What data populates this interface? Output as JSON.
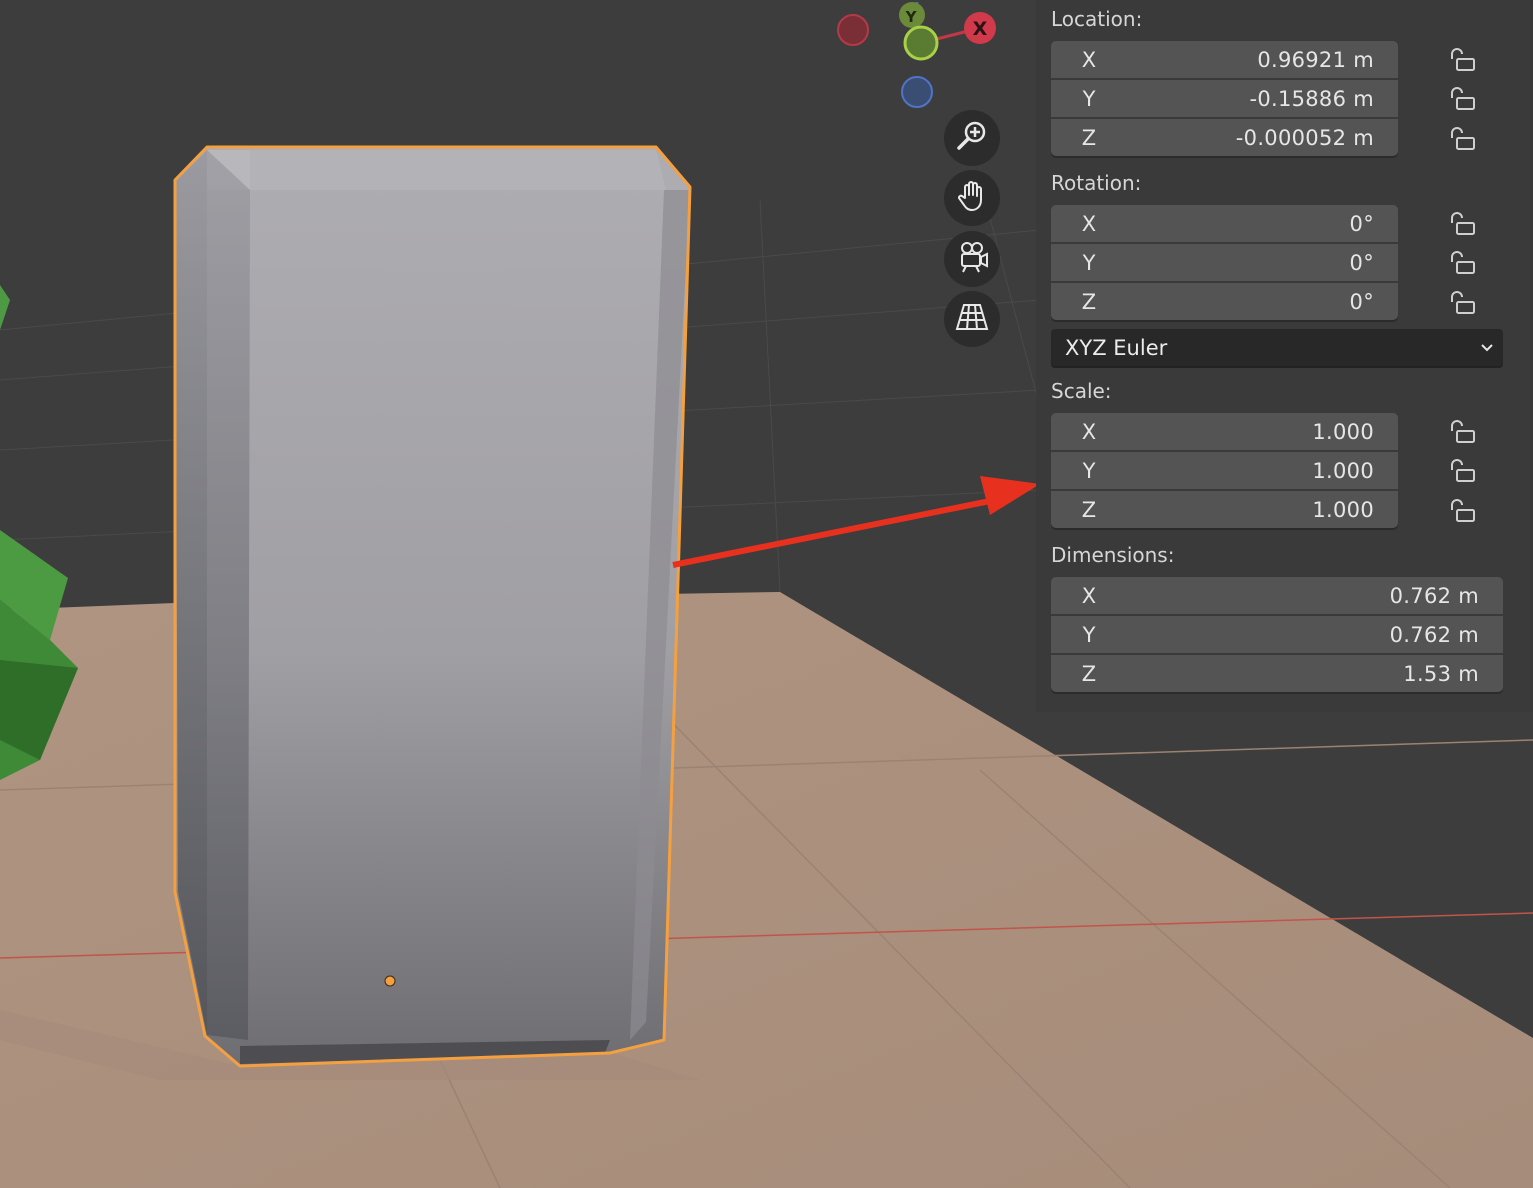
{
  "viewport": {
    "colors": {
      "background": "#3d3d3d",
      "floor": "#a8907e",
      "object": "#a7a6aa",
      "selection_outline": "#f5a040",
      "annotation_arrow": "#e8301f"
    },
    "gizmo": {
      "x_label": "X",
      "y_label": "Y"
    },
    "nav_buttons": [
      {
        "icon": "zoom-icon"
      },
      {
        "icon": "pan-hand-icon"
      },
      {
        "icon": "camera-view-icon"
      },
      {
        "icon": "perspective-grid-icon"
      }
    ]
  },
  "transform": {
    "location": {
      "label": "Location:",
      "rows": [
        {
          "axis": "X",
          "value": "0.96921 m"
        },
        {
          "axis": "Y",
          "value": "-0.15886 m"
        },
        {
          "axis": "Z",
          "value": "-0.000052 m"
        }
      ]
    },
    "rotation": {
      "label": "Rotation:",
      "rows": [
        {
          "axis": "X",
          "value": "0°"
        },
        {
          "axis": "Y",
          "value": "0°"
        },
        {
          "axis": "Z",
          "value": "0°"
        }
      ],
      "mode": "XYZ Euler"
    },
    "scale": {
      "label": "Scale:",
      "rows": [
        {
          "axis": "X",
          "value": "1.000"
        },
        {
          "axis": "Y",
          "value": "1.000"
        },
        {
          "axis": "Z",
          "value": "1.000"
        }
      ]
    },
    "dimensions": {
      "label": "Dimensions:",
      "rows": [
        {
          "axis": "X",
          "value": "0.762 m"
        },
        {
          "axis": "Y",
          "value": "0.762 m"
        },
        {
          "axis": "Z",
          "value": "1.53 m"
        }
      ]
    }
  }
}
